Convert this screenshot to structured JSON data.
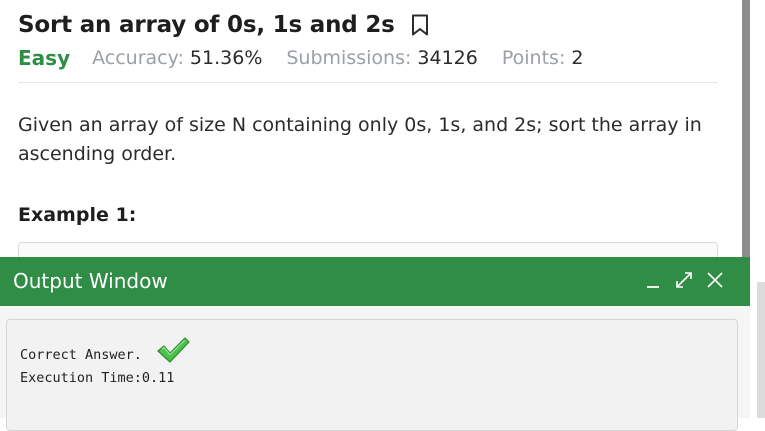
{
  "problem": {
    "title": "Sort an array of 0s, 1s and 2s",
    "difficulty": "Easy",
    "accuracy_label": "Accuracy:",
    "accuracy_value": "51.36%",
    "submissions_label": "Submissions:",
    "submissions_value": "34126",
    "points_label": "Points:",
    "points_value": "2",
    "statement": "Given an array of size N containing only 0s, 1s, and 2s; sort the array in ascending order.",
    "example_heading": "Example 1:"
  },
  "output_window": {
    "title": "Output Window",
    "result": "Correct Answer.",
    "execution_time": "Execution Time:0.11"
  },
  "colors": {
    "accent_green": "#2f8d46",
    "muted_text": "#9aa0a6",
    "check_green": "#3fbf3f"
  },
  "icons": {
    "bookmark": "bookmark-icon",
    "minimize": "minimize-icon",
    "expand": "expand-icon",
    "close": "close-icon",
    "check": "checkmark-icon"
  }
}
